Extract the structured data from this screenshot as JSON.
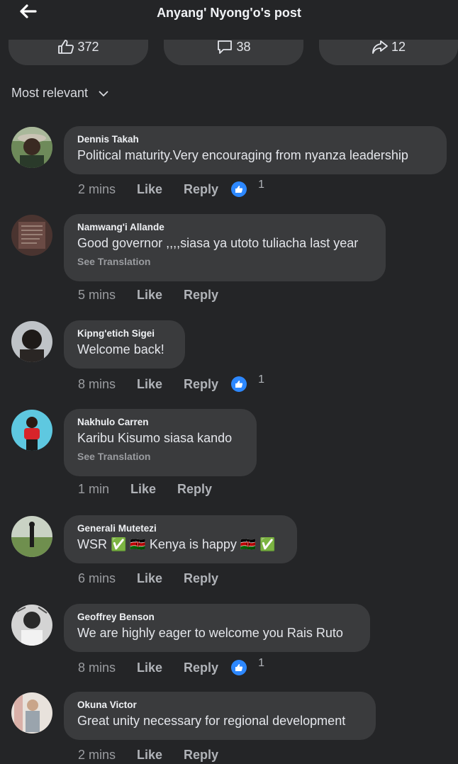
{
  "header": {
    "title": "Anyang' Nyong'o's post",
    "back_icon": "back-arrow-icon"
  },
  "stats": {
    "likes": "372",
    "comments": "38",
    "shares": "12"
  },
  "sort": {
    "label": "Most relevant"
  },
  "colors": {
    "background": "#242527",
    "bubble": "#3a3b3d",
    "like_blue": "#2d88ff"
  },
  "comments": [
    {
      "name": "Dennis Takah",
      "text": "Political maturity.Very encouraging from nyanza leadership",
      "see_translation": "",
      "time": "2 mins",
      "like": "Like",
      "reply": "Reply",
      "reactions": "1"
    },
    {
      "name": "Namwang'i Allande",
      "text": "Good governor ,,,,siasa ya utoto tuliacha last year",
      "see_translation": "See Translation",
      "time": "5 mins",
      "like": "Like",
      "reply": "Reply",
      "reactions": ""
    },
    {
      "name": "Kipng'etich Sigei",
      "text": "Welcome back!",
      "see_translation": "",
      "time": "8 mins",
      "like": "Like",
      "reply": "Reply",
      "reactions": "1"
    },
    {
      "name": "Nakhulo Carren",
      "text": "Karibu Kisumo siasa kando",
      "see_translation": "See Translation",
      "time": "1 min",
      "like": "Like",
      "reply": "Reply",
      "reactions": ""
    },
    {
      "name": "Generali Mutetezi",
      "text": "WSR ✅ 🇰🇪 Kenya is happy 🇰🇪 ✅",
      "see_translation": "",
      "time": "6 mins",
      "like": "Like",
      "reply": "Reply",
      "reactions": ""
    },
    {
      "name": "Geoffrey Benson",
      "text": "We are highly eager to welcome you Rais Ruto",
      "see_translation": "",
      "time": "8 mins",
      "like": "Like",
      "reply": "Reply",
      "reactions": "1"
    },
    {
      "name": "Okuna Victor",
      "text": "Great unity necessary for regional development",
      "see_translation": "",
      "time": "2 mins",
      "like": "Like",
      "reply": "Reply",
      "reactions": ""
    }
  ]
}
